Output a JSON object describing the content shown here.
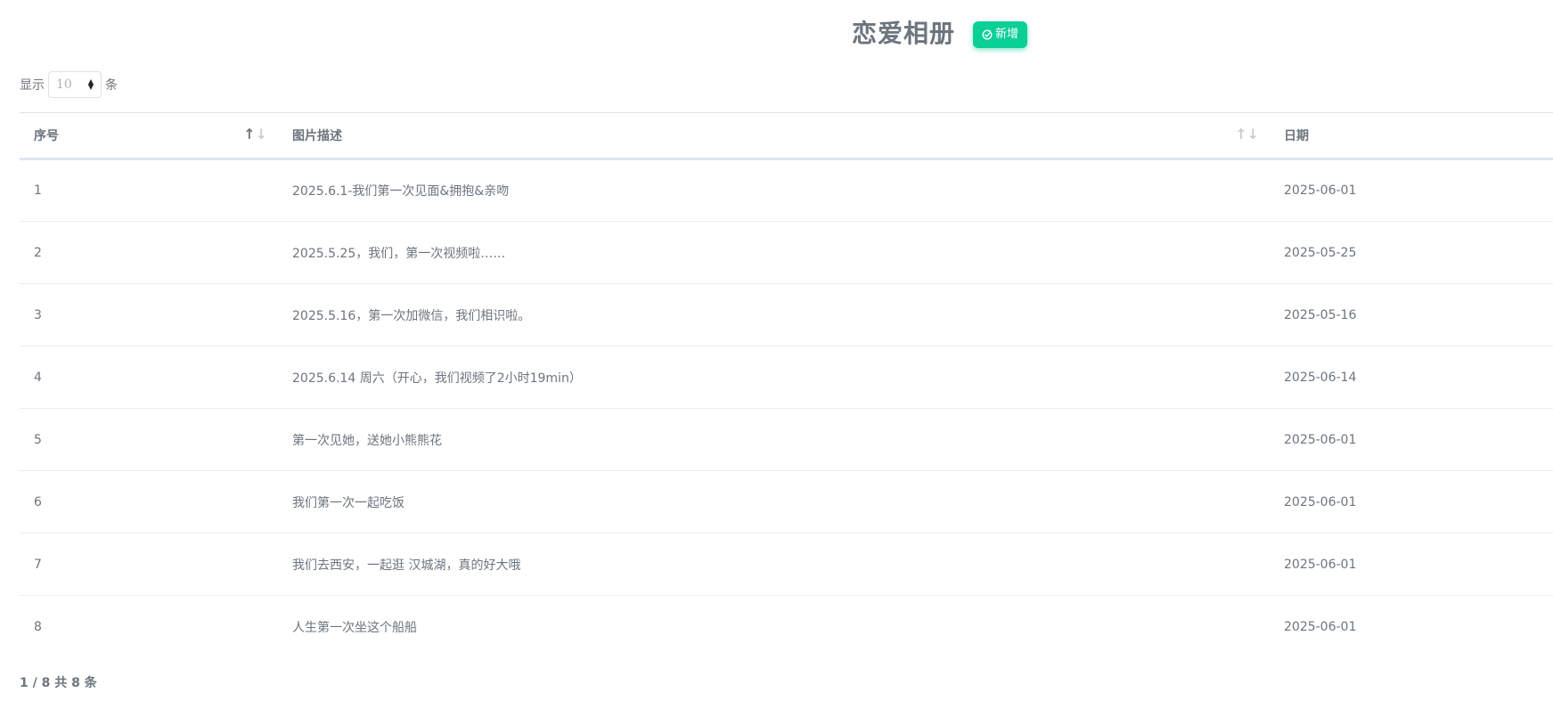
{
  "header": {
    "title": "恋爱相册",
    "add_button_label": "新增",
    "add_button_icon": "check-circle-icon",
    "accent_color": "#0acf97"
  },
  "length_control": {
    "prefix": "显示",
    "selected": "10",
    "suffix": "条"
  },
  "table": {
    "columns": [
      {
        "label": "序号",
        "sort": "ascending"
      },
      {
        "label": "图片描述",
        "sort": "none"
      },
      {
        "label": "日期",
        "sort": "none"
      }
    ],
    "rows": [
      {
        "index": "1",
        "description": "2025.6.1-我们第一次见面&拥抱&亲吻",
        "date": "2025-06-01"
      },
      {
        "index": "2",
        "description": "2025.5.25，我们，第一次视频啦……",
        "date": "2025-05-25"
      },
      {
        "index": "3",
        "description": "2025.5.16，第一次加微信，我们相识啦。",
        "date": "2025-05-16"
      },
      {
        "index": "4",
        "description": "2025.6.14 周六（开心，我们视频了2小时19min）",
        "date": "2025-06-14"
      },
      {
        "index": "5",
        "description": "第一次见她，送她小熊熊花",
        "date": "2025-06-01"
      },
      {
        "index": "6",
        "description": "我们第一次一起吃饭",
        "date": "2025-06-01"
      },
      {
        "index": "7",
        "description": "我们去西安，一起逛 汉城湖，真的好大哦",
        "date": "2025-06-01"
      },
      {
        "index": "8",
        "description": "人生第一次坐这个船船",
        "date": "2025-06-01"
      }
    ]
  },
  "footer": {
    "info": "1 / 8 共 8 条"
  }
}
